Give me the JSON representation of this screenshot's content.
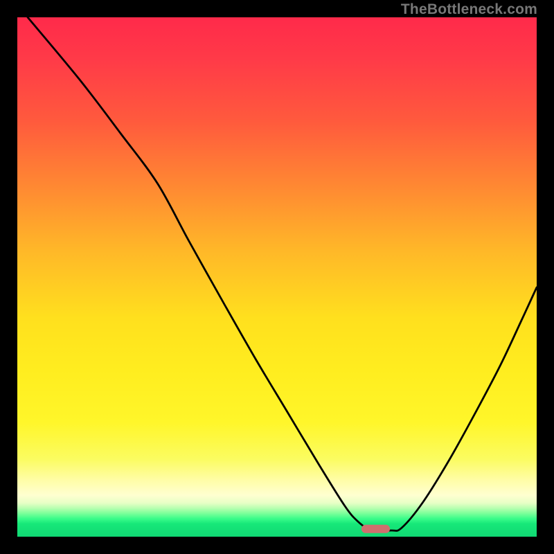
{
  "watermark": "TheBottleneck.com",
  "chart_data": {
    "type": "line",
    "title": "",
    "xlabel": "",
    "ylabel": "",
    "xlim": [
      0,
      100
    ],
    "ylim": [
      0,
      100
    ],
    "series": [
      {
        "name": "curve",
        "x": [
          2,
          12,
          20,
          27,
          33,
          40,
          46,
          52,
          58,
          63,
          65.5,
          68,
          72,
          74,
          78,
          83,
          88,
          93,
          97,
          100
        ],
        "values": [
          100,
          88,
          77.5,
          68,
          57,
          44.5,
          34,
          24,
          14,
          6,
          3,
          1.4,
          1.2,
          1.7,
          6.5,
          14.5,
          23.5,
          33,
          41.5,
          48
        ]
      }
    ],
    "marker": {
      "x": 69,
      "y": 1.5,
      "width_pct": 5.5,
      "height_pct": 1.6,
      "color": "#cf6f6e"
    }
  }
}
